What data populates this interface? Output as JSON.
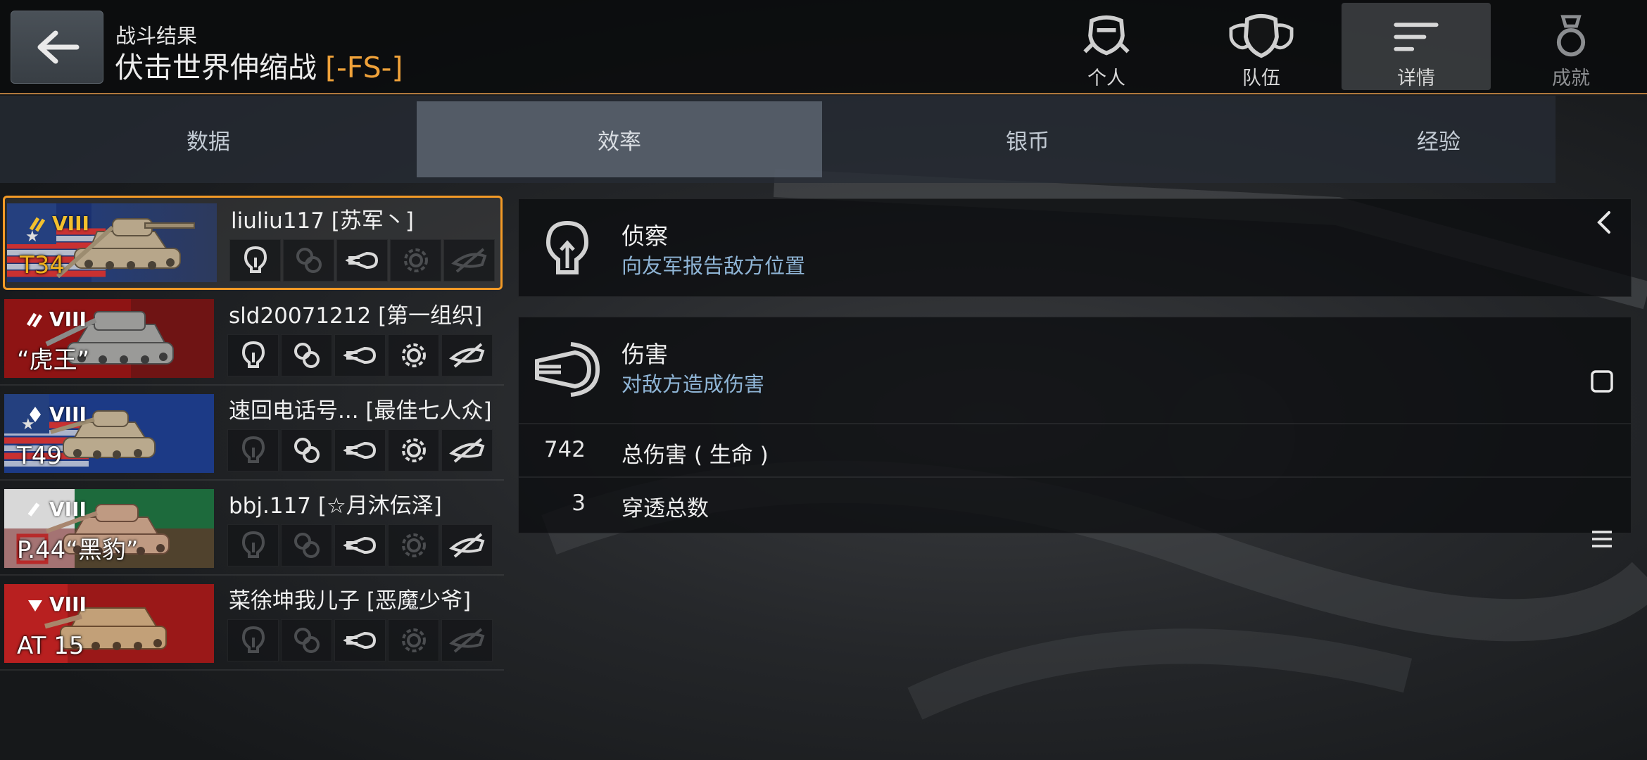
{
  "header": {
    "subtitle": "战斗结果",
    "title": "伏击世界伸缩战",
    "tag": "[-FS-]"
  },
  "nav": [
    {
      "label": "个人",
      "icon": "helmet-icon"
    },
    {
      "label": "队伍",
      "icon": "team-icon"
    },
    {
      "label": "详情",
      "icon": "details-icon",
      "active": true
    },
    {
      "label": "成就",
      "icon": "medal-icon"
    }
  ],
  "tabs": [
    {
      "label": "数据"
    },
    {
      "label": "效率",
      "active": true
    },
    {
      "label": "银币"
    },
    {
      "label": "经验"
    }
  ],
  "players": [
    {
      "name": "liuliu117 [苏军丶]",
      "tank": "T34",
      "tier": "VIII",
      "flag": "usa",
      "premium": true,
      "icons": [
        true,
        false,
        true,
        false,
        false
      ]
    },
    {
      "name": "sld20071212 [第一组织]",
      "tank": "“虎王”",
      "tier": "VIII",
      "flag": "germany",
      "premium": false,
      "icons": [
        true,
        true,
        true,
        true,
        true
      ]
    },
    {
      "name": "速回电话号... [最佳七人众]",
      "tank": "T49",
      "tier": "VIII",
      "flag": "usa",
      "premium": false,
      "icons": [
        false,
        true,
        true,
        true,
        true
      ]
    },
    {
      "name": "bbj.117 [☆月沐伝泽]",
      "tank": "P.44“黑豹”",
      "tier": "VIII",
      "flag": "italy",
      "premium": false,
      "icons": [
        false,
        false,
        true,
        false,
        true
      ]
    },
    {
      "name": "菜徐坤我儿子 [恶魔少爷]",
      "tank": "AT 15",
      "tier": "VIII",
      "flag": "uk",
      "premium": false,
      "icons": [
        false,
        false,
        true,
        false,
        false
      ]
    }
  ],
  "details": {
    "recon": {
      "title": "侦察",
      "desc": "向友军报告敌方位置",
      "icon": "lightbulb-icon"
    },
    "damage": {
      "title": "伤害",
      "desc": "对敌方造成伤害",
      "icon": "shell-icon",
      "stats": [
        {
          "value": "742",
          "label": "总伤害 ( 生命 )"
        },
        {
          "value": "3",
          "label": "穿透总数"
        }
      ]
    }
  },
  "colors": {
    "accent": "#f39a26",
    "tag": "#f0a23a",
    "subtext": "#8fb5d6"
  }
}
